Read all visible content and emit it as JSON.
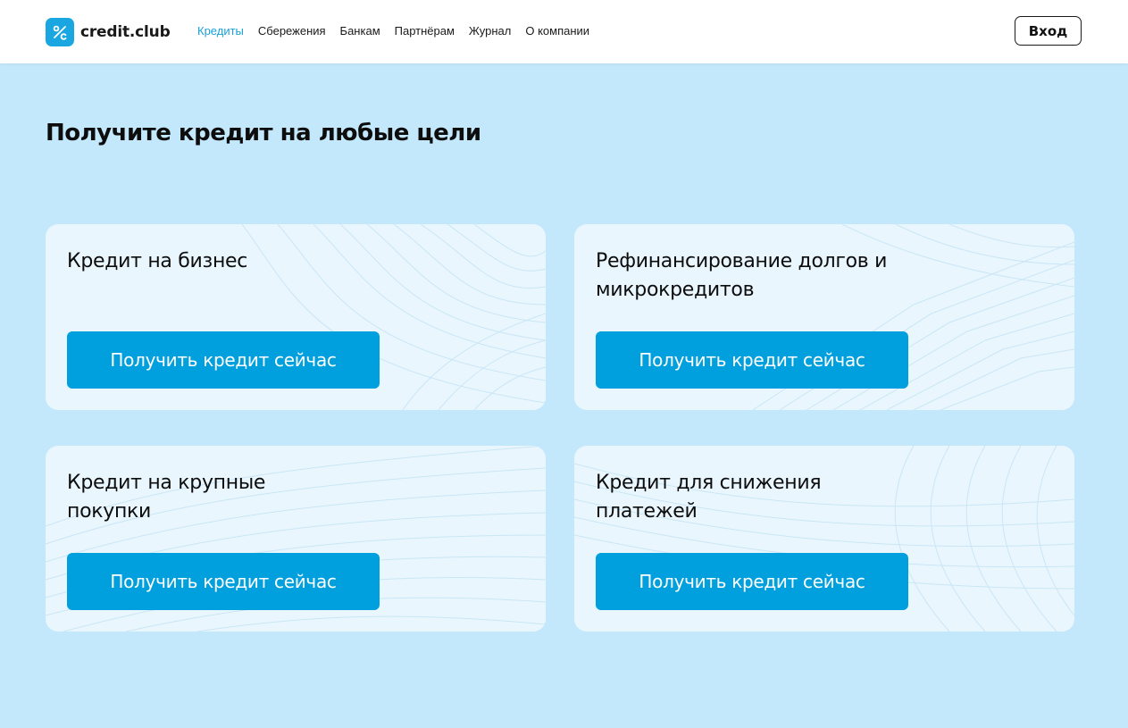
{
  "header": {
    "logo_text": "credit.club",
    "logo_icon": "percent-badge-icon",
    "nav": [
      {
        "label": "Кредиты",
        "active": true
      },
      {
        "label": "Сбережения",
        "active": false
      },
      {
        "label": "Банкам",
        "active": false
      },
      {
        "label": "Партнёрам",
        "active": false
      },
      {
        "label": "Журнал",
        "active": false
      },
      {
        "label": "О компании",
        "active": false
      }
    ],
    "login_label": "Вход"
  },
  "main": {
    "title": "Получите кредит на любые цели",
    "cards": [
      {
        "title": "Кредит на бизнес",
        "button_label": "Получить кредит сейчас"
      },
      {
        "title": "Рефинансирование долгов и микрокредитов",
        "button_label": "Получить кредит сейчас"
      },
      {
        "title": "Кредит на крупные покупки",
        "button_label": "Получить кредит сейчас"
      },
      {
        "title": "Кредит для снижения платежей",
        "button_label": "Получить кредит сейчас"
      }
    ]
  },
  "colors": {
    "page_background": "#c3e7fb",
    "card_background": "#eaf6fd",
    "accent": "#009fdd",
    "active_nav": "#1aa0d8"
  }
}
